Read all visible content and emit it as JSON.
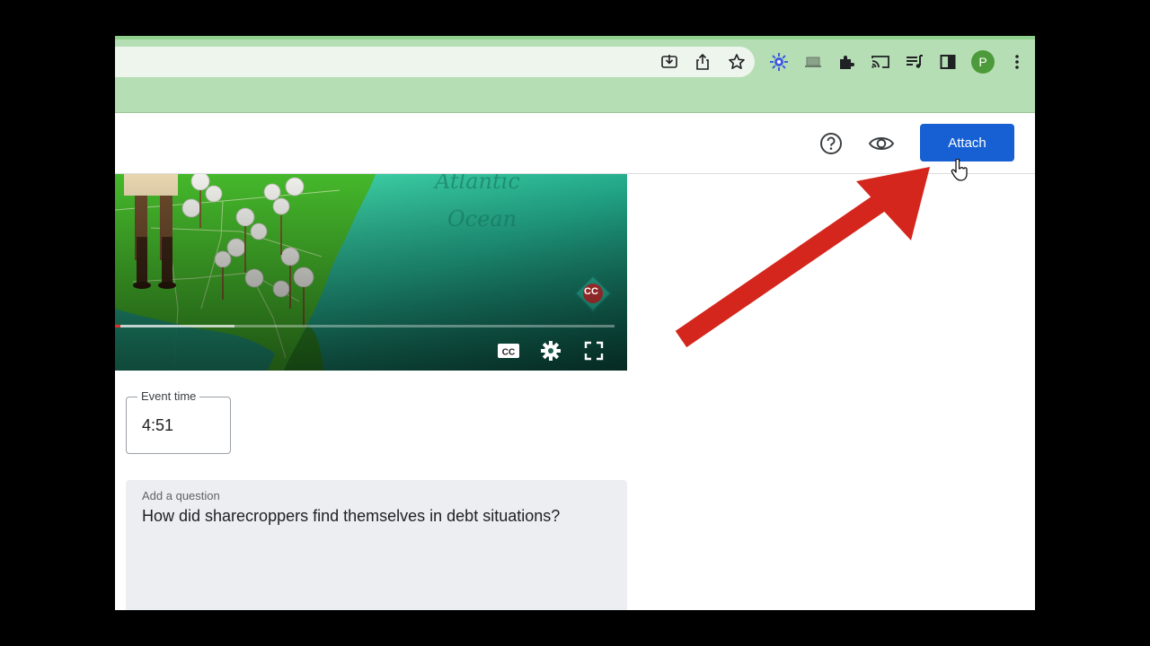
{
  "toolbar": {
    "icons": [
      "install-app-icon",
      "share-icon",
      "bookmark-star-icon",
      "extension-sparkle-icon",
      "laptop-icon",
      "extensions-puzzle-icon",
      "cast-icon",
      "reading-list-icon",
      "side-panel-icon",
      "profile-avatar",
      "kebab-menu-icon"
    ],
    "avatar_letter": "P"
  },
  "header": {
    "attach_label": "Attach",
    "help_icon": "help-circle-icon",
    "preview_icon": "eye-icon"
  },
  "video": {
    "map_label_1": "Atlantic",
    "map_label_2": "Ocean",
    "badge": "CC",
    "progress_fraction": 0.24,
    "played_fraction": 0.01,
    "controls": [
      "captions-icon",
      "settings-gear-icon",
      "fullscreen-icon"
    ]
  },
  "event_time": {
    "label": "Event time",
    "value": "4:51"
  },
  "question": {
    "label": "Add a question",
    "text": "How did sharecroppers find themselves in debt situations?"
  },
  "colors": {
    "accent": "#1660d3",
    "chrome": "#b6deb4",
    "annotation_arrow": "#d4261c"
  }
}
